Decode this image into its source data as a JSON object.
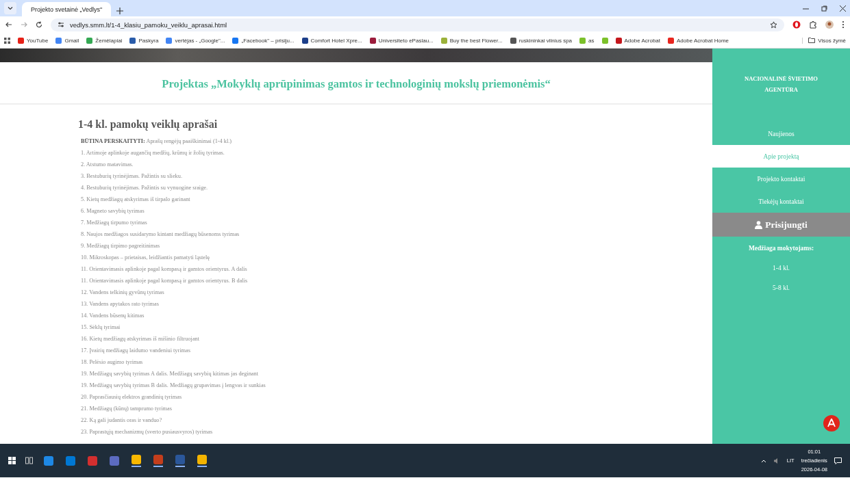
{
  "browser": {
    "tab": {
      "title": "Projekto svetainė „Vedlys\"",
      "selected": true
    },
    "url": "vedlys.smm.lt/1-4_klasiu_pamoku_veiklu_aprasai.html",
    "bookmarks": [
      {
        "label": "YouTube",
        "color": "#e62117"
      },
      {
        "label": "Gmail",
        "color": "#4285f4"
      },
      {
        "label": "Žemėlapiai",
        "color": "#34a853"
      },
      {
        "label": "Paskyra",
        "color": "#2a5caa"
      },
      {
        "label": "vertėjas - „Google\"...",
        "color": "#4285f4"
      },
      {
        "label": "„Facebook\" – prisiju...",
        "color": "#1877f2"
      },
      {
        "label": "Comfort Hotel Xpre...",
        "color": "#1d3f8a"
      },
      {
        "label": "Universiteto ePaslau...",
        "color": "#9c1c3c"
      },
      {
        "label": "Buy the best Flower...",
        "color": "#9bb13a"
      },
      {
        "label": "ruskininkai vilnius spa",
        "color": "#555555"
      },
      {
        "label": "as",
        "color": "#7cc12b"
      },
      {
        "color": "#7cc12b"
      },
      {
        "label": "Adobe Acrobat",
        "color": "#c4161c"
      },
      {
        "label": "Adobe Acrobat Home",
        "color": "#e8261f"
      }
    ],
    "all_bookmarks": "Visos žymė"
  },
  "page": {
    "project_title": "Projektas „Mokyklų aprūpinimas gamtos ir technologinių mokslų priemonėmis“",
    "heading": "1-4 kl. pamokų veiklų aprašai",
    "notice": "**BŪTINA PERSKAITYTI:** Aprašų rengėjų paaiškinimai (1-4 kl.)",
    "items": [
      "1. Artimoje aplinkoje augančių medžių, krūmų ir žolių tyrimas.",
      "2. Atstumo matavimas.",
      "3. Bestuburių tyrinėjimas. Pažintis su slieku.",
      "4. Bestuburių tyrinėjimas. Pažintis su vynuogine sraige.",
      "5. Kietų medžiagų atskyrimas iš tirpalo garinant",
      "6. Magneto savybių tyrimas",
      "7. Medžiagų tirpumo tyrimas",
      "8. Naujos medžiagos susidarymo kintant medžiagų būsenoms tyrimas",
      "9. Medžiagų tirpimo pagreitinimas",
      "10. Mikroskopas – prietaisas, leidžiantis pamatyti ląstelę",
      "11. Orientavimasis aplinkoje pagal kompasą ir gamtos orientyrus. A dalis",
      "11. Orientavimasis aplinkoje pagal kompasą ir gamtos orientyrus. B dalis",
      "12. Vandens telkinių gyvūnų tyrimas",
      "13. Vandens apytakos rato tyrimas",
      "14. Vandens būsenų kitimas",
      "15. Sėklų tyrimai",
      "16. Kietų medžiagų atskyrimas iš mišinio filtruojant",
      "17. Įvairių medžiagų laidumo vandeniui tyrimas",
      "18. Pelėsio augimo tyrimas",
      "19. Medžiagų savybių tyrimas A dalis. Medžiagų savybių kitimas jas deginant",
      "19. Medžiagų savybių tyrimas B dalis. Medžiagų grupavimas į lengvas ir sunkias",
      "20. Paprasčiausių elektros grandinių tyrimas",
      "21. Medžiagų (kūnų) tamprumo tyrimas",
      "22. Ką gali judantis oras ir vanduo?",
      "23. Paprastųjų mechanizmų (sverto pusiausvyros) tyrimas"
    ]
  },
  "sidebar": {
    "agency": "NACIONALINĖ ŠVIETIMO AGENTŪRA",
    "nav": [
      {
        "label": "Naujienos",
        "selected": false
      },
      {
        "label": "Apie projektą",
        "selected": true
      },
      {
        "label": "Projekto kontaktai",
        "selected": false
      },
      {
        "label": "Tiekėjų kontaktai",
        "selected": false
      }
    ],
    "login": "Prisijungti",
    "materials_heading": "Medžiaga mokytojams:",
    "materials": [
      "1-4 kl.",
      "5-8 kl."
    ]
  },
  "taskbar": {
    "apps": [
      {
        "color": "#1e88e5",
        "running": false
      },
      {
        "color": "#0078d4",
        "running": false
      },
      {
        "color": "#d32f2f",
        "running": false
      },
      {
        "color": "#5c6bc0",
        "running": false
      },
      {
        "color": "#f9b800",
        "running": true
      },
      {
        "color": "#c43e1c",
        "running": true
      },
      {
        "color": "#2b579a",
        "running": true
      },
      {
        "color": "#f4b400",
        "running": true
      }
    ],
    "language": "LIT",
    "time": "01:01",
    "day": "trečiadienis",
    "date": "2026-04-08"
  }
}
